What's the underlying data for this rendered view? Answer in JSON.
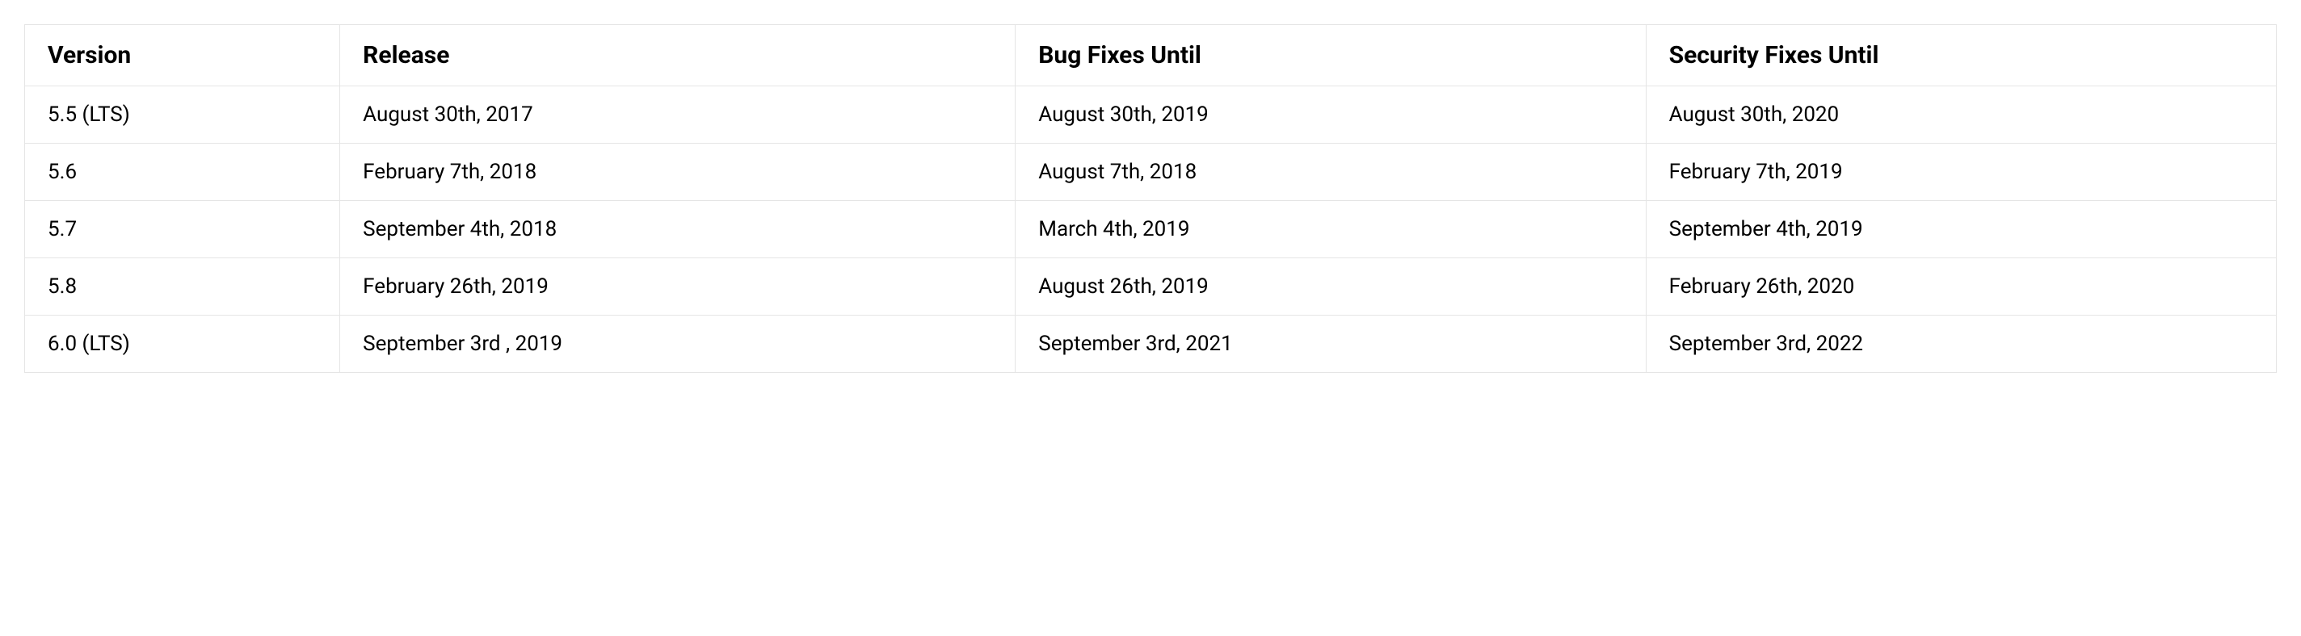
{
  "table": {
    "headers": {
      "version": "Version",
      "release": "Release",
      "bug_fixes_until": "Bug Fixes Until",
      "security_fixes_until": "Security Fixes Until"
    },
    "rows": [
      {
        "version": "5.5 (LTS)",
        "release": "August 30th, 2017",
        "bug_fixes_until": "August 30th, 2019",
        "security_fixes_until": "August 30th, 2020"
      },
      {
        "version": "5.6",
        "release": "February 7th, 2018",
        "bug_fixes_until": "August 7th, 2018",
        "security_fixes_until": "February 7th, 2019"
      },
      {
        "version": "5.7",
        "release": "September 4th, 2018",
        "bug_fixes_until": "March 4th, 2019",
        "security_fixes_until": "September 4th, 2019"
      },
      {
        "version": "5.8",
        "release": "February 26th, 2019",
        "bug_fixes_until": "August 26th, 2019",
        "security_fixes_until": "February 26th, 2020"
      },
      {
        "version": "6.0 (LTS)",
        "release": "September 3rd , 2019",
        "bug_fixes_until": "September 3rd, 2021",
        "security_fixes_until": "September 3rd, 2022"
      }
    ]
  }
}
